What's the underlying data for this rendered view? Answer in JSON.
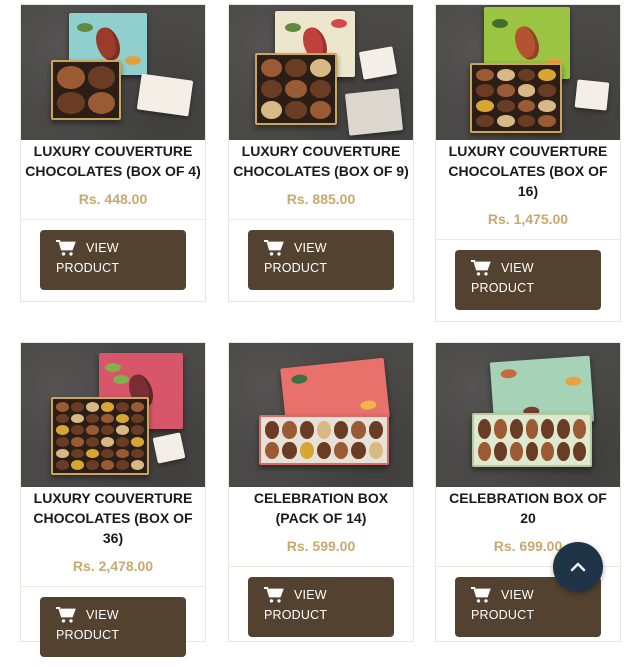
{
  "products": [
    {
      "name": "LUXURY COUVERTURE CHOCOLATES (BOX OF 4)",
      "price": "Rs. 448.00",
      "button_line1": "VIEW",
      "button_line2": "PRODUCT",
      "lid_color": "#8fd0cf"
    },
    {
      "name": "LUXURY COUVERTURE CHOCOLATES (BOX OF 9)",
      "price": "Rs. 885.00",
      "button_line1": "VIEW",
      "button_line2": "PRODUCT",
      "lid_color": "#ece6cc"
    },
    {
      "name": "LUXURY COUVERTURE CHOCOLATES (BOX OF 16)",
      "price": "Rs. 1,475.00",
      "button_line1": "VIEW",
      "button_line2": "PRODUCT",
      "lid_color": "#9bc443"
    },
    {
      "name": "LUXURY COUVERTURE CHOCOLATES (BOX OF 36)",
      "price": "Rs. 2,478.00",
      "button_line1": "VIEW",
      "button_line2": "PRODUCT",
      "lid_color": "#d8566a"
    },
    {
      "name": "CELEBRATION BOX (PACK OF 14)",
      "price": "Rs. 599.00",
      "button_line1": "VIEW",
      "button_line2": "PRODUCT",
      "lid_color": "#e9716c"
    },
    {
      "name": "CELEBRATION BOX OF 20",
      "price": "Rs. 699.00",
      "button_line1": "VIEW",
      "button_line2": "PRODUCT",
      "lid_color": "#a6d3b7"
    }
  ],
  "icons": {
    "cart": "cart-icon",
    "back_to_top": "chevron-up-icon"
  },
  "colors": {
    "button_bg": "#52422f",
    "price": "#c7a96e",
    "back_to_top_bg": "#1f3447"
  }
}
